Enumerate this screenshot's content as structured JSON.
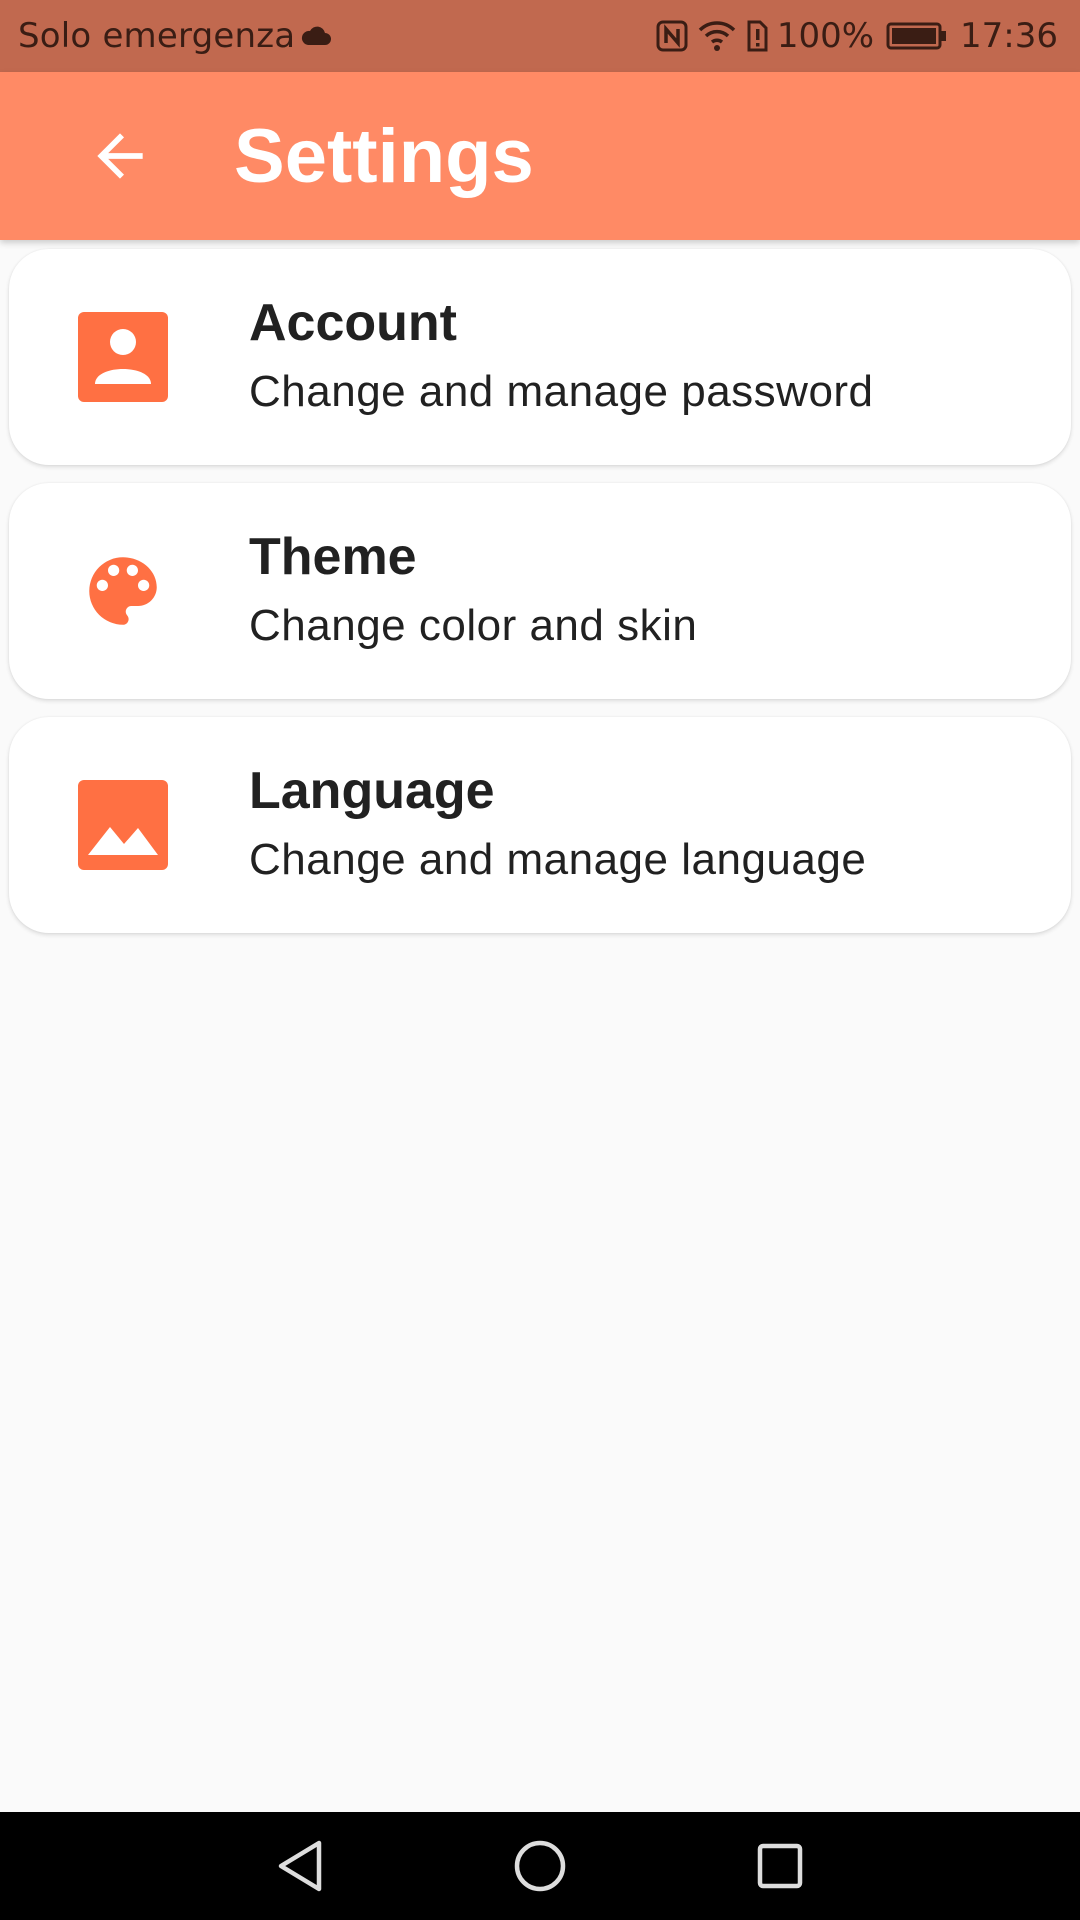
{
  "status_bar": {
    "carrier": "Solo emergenza",
    "battery": "100%",
    "time": "17:36",
    "icons": [
      "cloud-icon",
      "nfc-icon",
      "wifi-icon",
      "alert-icon",
      "battery-icon"
    ]
  },
  "app_bar": {
    "title": "Settings",
    "back_icon": "arrow-back-icon",
    "color": "#ff8a65"
  },
  "settings": [
    {
      "title": "Account",
      "subtitle": "Change and manage password",
      "icon": "account-box-icon"
    },
    {
      "title": "Theme",
      "subtitle": "Change color and skin",
      "icon": "palette-icon"
    },
    {
      "title": "Language",
      "subtitle": "Change and manage language",
      "icon": "image-icon"
    }
  ],
  "colors": {
    "accent": "#ff7043",
    "status_bar": "#c1694f",
    "background": "#fafafa"
  },
  "nav_bar": {
    "buttons": [
      "nav-back-icon",
      "nav-home-icon",
      "nav-recents-icon"
    ]
  }
}
